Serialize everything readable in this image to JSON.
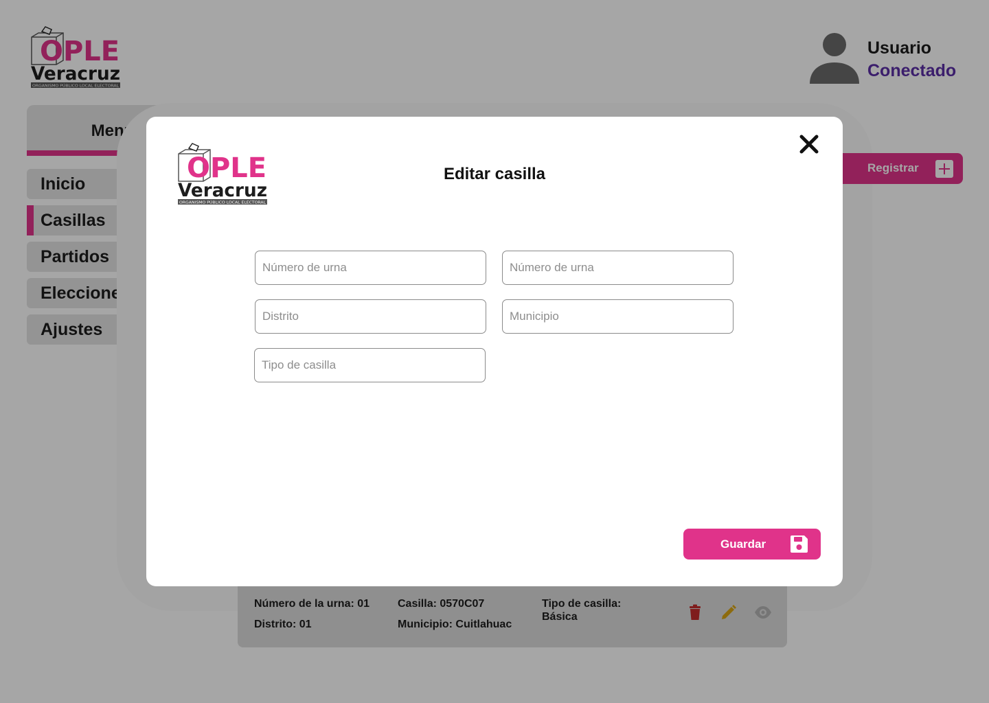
{
  "brand": {
    "name": "OPLE",
    "region": "Veracruz",
    "tagline": "ORGANISMO PÚBLICO LOCAL ELECTORAL",
    "primary_color": "#e0338a",
    "accent_color": "#5b2ea6"
  },
  "user": {
    "name": "Usuario",
    "status": "Conectado",
    "icon": "user-avatar-icon"
  },
  "sidebar": {
    "title": "Menú",
    "items": [
      {
        "label": "Inicio",
        "active": false
      },
      {
        "label": "Casillas",
        "active": true
      },
      {
        "label": "Partidos",
        "active": false
      },
      {
        "label": "Elecciones",
        "active": false
      },
      {
        "label": "Ajustes",
        "active": false
      }
    ]
  },
  "toolbar": {
    "register_label": "Registrar",
    "register_icon": "plus-icon"
  },
  "record": {
    "urna": "Número de la urna: 01",
    "distrito": "Distrito: 01",
    "casilla": "Casilla: 0570C07",
    "municipio": "Municipio: Cuitlahuac",
    "tipo_label": "Tipo de casilla:",
    "tipo_value": "Básica",
    "actions": [
      "trash-icon",
      "pencil-icon",
      "eye-icon"
    ]
  },
  "modal": {
    "title": "Editar casilla",
    "close_icon": "close-icon",
    "fields": {
      "urna_1": {
        "placeholder": "Número de urna",
        "value": ""
      },
      "urna_2": {
        "placeholder": "Número de urna",
        "value": ""
      },
      "distrito": {
        "placeholder": "Distrito",
        "value": ""
      },
      "municipio": {
        "placeholder": "Municipio",
        "value": ""
      },
      "tipo": {
        "placeholder": "Tipo de casilla",
        "value": ""
      }
    },
    "save_label": "Guardar",
    "save_icon": "floppy-disk-icon"
  }
}
